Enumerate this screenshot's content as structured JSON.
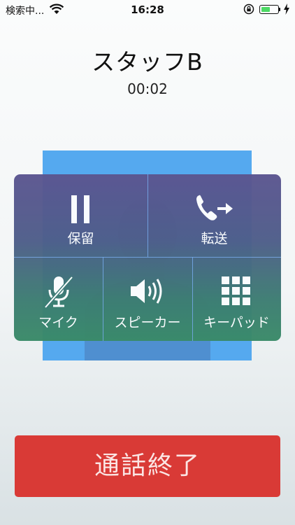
{
  "status_bar": {
    "carrier": "検索中...",
    "time": "16:28",
    "battery_level": 0.55,
    "icons": [
      "wifi-icon",
      "rotation-lock-icon",
      "battery-icon",
      "charging-bolt-icon"
    ]
  },
  "call": {
    "contact_name": "スタッフB",
    "duration": "00:02"
  },
  "controls": {
    "hold_label": "保留",
    "transfer_label": "転送",
    "mute_label": "マイク",
    "speaker_label": "スピーカー",
    "keypad_label": "キーパッド"
  },
  "end_call": {
    "label": "通話終了"
  },
  "colors": {
    "end_call": "#d93a36",
    "video_background": "#55a9ef",
    "panel_top": "#5c5590",
    "panel_bottom": "#3a8a68"
  }
}
